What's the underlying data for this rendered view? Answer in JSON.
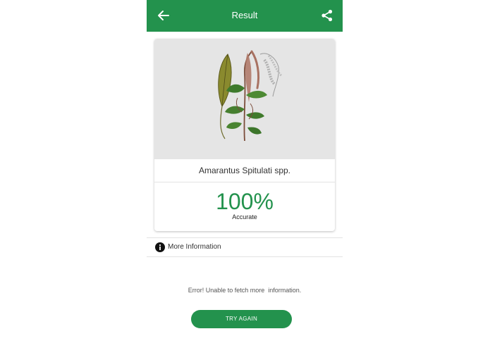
{
  "appbar": {
    "title": "Result",
    "back_icon": "arrow-left-icon",
    "share_icon": "share-icon",
    "color": "#23924d"
  },
  "result": {
    "species_name": "Amarantus Spitulati spp.",
    "confidence": "100%",
    "confidence_label": "Accurate"
  },
  "info": {
    "icon": "info-icon",
    "label": "More Information"
  },
  "error": {
    "message": "Error! Unable to fetch more  information.",
    "retry_label": "TRY AGAIN"
  }
}
